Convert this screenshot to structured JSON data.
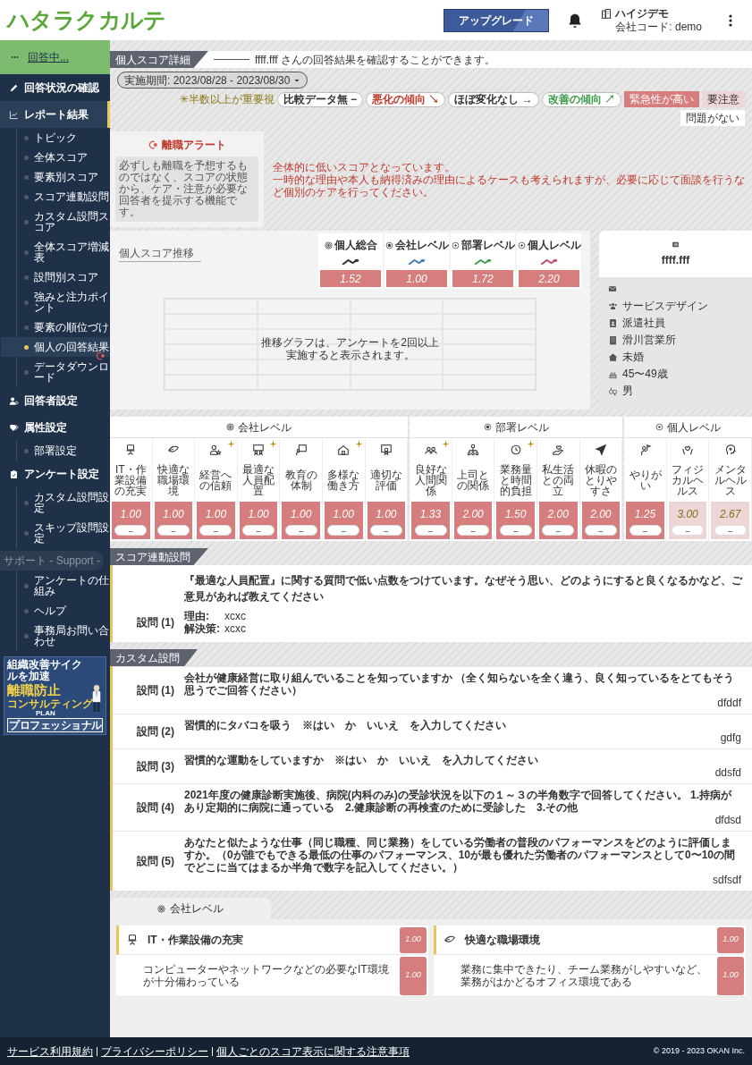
{
  "header": {
    "logo": "ハタラクカルテ",
    "upgrade_button": "アップグレード",
    "company_name": "ハイジデモ",
    "company_code": "会社コード: demo"
  },
  "sidebar": {
    "status": "回答中...",
    "items": [
      {
        "label": "回答状況の確認",
        "selected": false
      },
      {
        "label": "レポート結果",
        "selected": true,
        "children": [
          {
            "label": "トピック",
            "selected": false,
            "alert": false
          },
          {
            "label": "全体スコア",
            "selected": false,
            "alert": false
          },
          {
            "label": "要素別スコア",
            "selected": false,
            "alert": false
          },
          {
            "label": "スコア連動設問",
            "selected": false,
            "alert": false
          },
          {
            "label": "カスタム設問スコア",
            "selected": false,
            "alert": false
          },
          {
            "label": "全体スコア増減表",
            "selected": false,
            "alert": false
          },
          {
            "label": "設問別スコア",
            "selected": false,
            "alert": false
          },
          {
            "label": "強みと注力ポイント",
            "selected": false,
            "alert": false
          },
          {
            "label": "要素の順位づけ",
            "selected": false,
            "alert": false
          },
          {
            "label": "個人の回答結果",
            "selected": true,
            "alert": true
          },
          {
            "label": "データダウンロード",
            "selected": false,
            "alert": false
          }
        ]
      },
      {
        "label": "回答者設定",
        "selected": false
      },
      {
        "label": "属性設定",
        "selected": false,
        "children": [
          {
            "label": "部署設定",
            "selected": false,
            "alert": false
          }
        ]
      },
      {
        "label": "アンケート設定",
        "selected": false,
        "children": [
          {
            "label": "カスタム設問設定",
            "selected": false,
            "alert": false
          },
          {
            "label": "スキップ設問設定",
            "selected": false,
            "alert": false
          }
        ]
      }
    ],
    "support": {
      "label": "サポート - Support -",
      "items": [
        {
          "label": "アンケートの仕組み",
          "selected": false,
          "alert": false
        },
        {
          "label": "ヘルプ",
          "selected": false,
          "alert": false
        },
        {
          "label": "事務局お問い合わせ",
          "selected": false,
          "alert": false
        }
      ]
    },
    "banner": {
      "tagline": "組織改善サイクルを加速",
      "headline": "離職防止",
      "subline": "コンサルティング",
      "plan_label": "PLAN",
      "plan_name": "プロフェッショナル"
    }
  },
  "page": {
    "title": "個人スコア詳細",
    "description": "ffff.fff さんの回答結果を確認することができます。",
    "period": "実施期間: 2023/08/28 - 2023/08/30",
    "legend": [
      {
        "kind": "note",
        "mark": "✳",
        "label": "半数以上が重要視"
      },
      {
        "kind": "trend",
        "label": "比較データ無",
        "arrow": "−",
        "color": "#333333"
      },
      {
        "kind": "trend",
        "label": "悪化の傾向",
        "arrow": "↘",
        "color": "#c0392b"
      },
      {
        "kind": "trend",
        "label": "ほぼ変化なし",
        "arrow": "→",
        "color": "#333333"
      },
      {
        "kind": "trend",
        "label": "改善の傾向",
        "arrow": "↗",
        "color": "#3c9a4a"
      },
      {
        "kind": "status",
        "label": "緊急性が高い",
        "color": "#d67d7d"
      },
      {
        "kind": "status",
        "label": "要注意",
        "color": "#ecd6d6"
      },
      {
        "kind": "status",
        "label": "問題がない",
        "color": "#ffffff"
      }
    ]
  },
  "alert": {
    "title": "離職アラート",
    "description": "必ずしも離職を予想するものではなく、スコアの状態から、ケア・注意が必要な回答者を提示する機能です。",
    "message_lines": [
      "全体的に低いスコアとなっています。",
      "一時的な理由や本人も納得済みの理由によるケースも考えられますが、必要に応じて面談を行うなど個別のケアを行ってください。"
    ]
  },
  "trend": {
    "title": "個人スコア推移",
    "summaries": [
      {
        "label": "個人総合",
        "score": "1.52",
        "color": "#333333"
      },
      {
        "label": "会社レベル",
        "score": "1.00",
        "color": "#4a7fb5"
      },
      {
        "label": "部署レベル",
        "score": "1.72",
        "color": "#4a9a5a"
      },
      {
        "label": "個人レベル",
        "score": "2.20",
        "color": "#c0506a"
      }
    ],
    "empty_message_lines": [
      "推移グラフは、アンケートを2回以上",
      "実施すると表示されます。"
    ]
  },
  "profile": {
    "name": "ffff.fff",
    "attributes": [
      {
        "kind": "department",
        "value": "サービスデザイン"
      },
      {
        "kind": "employment",
        "value": "派遣社員"
      },
      {
        "kind": "office",
        "value": "滑川営業所"
      },
      {
        "kind": "marital",
        "value": "未婚"
      },
      {
        "kind": "age",
        "value": "45〜49歳"
      },
      {
        "kind": "gender",
        "value": "男"
      }
    ]
  },
  "scores": {
    "groups": [
      {
        "label": "会社レベル",
        "items": [
          {
            "label": "IT・作業設備の充実",
            "score": "1.00",
            "color": "#d67d7d",
            "important": false,
            "trend": "–"
          },
          {
            "label": "快適な職場環境",
            "score": "1.00",
            "color": "#d67d7d",
            "important": false,
            "trend": "–"
          },
          {
            "label": "経営への信頼",
            "score": "1.00",
            "color": "#d67d7d",
            "important": true,
            "trend": "–"
          },
          {
            "label": "最適な人員配置",
            "score": "1.00",
            "color": "#d67d7d",
            "important": true,
            "trend": "–"
          },
          {
            "label": "教育の体制",
            "score": "1.00",
            "color": "#d67d7d",
            "important": false,
            "trend": "–"
          },
          {
            "label": "多様な働き方",
            "score": "1.00",
            "color": "#d67d7d",
            "important": true,
            "trend": "–"
          },
          {
            "label": "適切な評価",
            "score": "1.00",
            "color": "#d67d7d",
            "important": false,
            "trend": "–"
          }
        ]
      },
      {
        "label": "部署レベル",
        "items": [
          {
            "label": "良好な人間関係",
            "score": "1.33",
            "color": "#d67d7d",
            "important": true,
            "trend": "–"
          },
          {
            "label": "上司との関係",
            "score": "2.00",
            "color": "#d67d7d",
            "important": false,
            "trend": "–"
          },
          {
            "label": "業務量と時間的負担",
            "score": "1.50",
            "color": "#d67d7d",
            "important": true,
            "trend": "–"
          },
          {
            "label": "私生活との両立",
            "score": "2.00",
            "color": "#d67d7d",
            "important": false,
            "trend": "–"
          },
          {
            "label": "休暇のとりやすさ",
            "score": "2.00",
            "color": "#d67d7d",
            "important": false,
            "trend": "–"
          }
        ]
      },
      {
        "label": "個人レベル",
        "items": [
          {
            "label": "やりがい",
            "score": "1.25",
            "color": "#d67d7d",
            "important": false,
            "trend": "–"
          },
          {
            "label": "フィジカルヘルス",
            "score": "3.00",
            "color": "#ecd6d6",
            "important": false,
            "trend": "–"
          },
          {
            "label": "メンタルヘルス",
            "score": "2.67",
            "color": "#ecd6d6",
            "important": false,
            "trend": "–"
          }
        ]
      }
    ]
  },
  "linked": {
    "title": "スコア連動設問",
    "questions": [
      {
        "number": "設問 (1)",
        "text": "『最適な人員配置』に関する質問で低い点数をつけています。なぜそう思い、どのようにすると良くなるかなど、ご意見があれば教えてください",
        "answers": [
          {
            "label": "理由:",
            "value": "xcxc"
          },
          {
            "label": "解決策:",
            "value": "xcxc"
          }
        ]
      }
    ]
  },
  "custom": {
    "title": "カスタム設問",
    "questions": [
      {
        "number": "設問 (1)",
        "text": "会社が健康経営に取り組んでいることを知っていますか （全く知らないを全く違う、良く知っているをとてもそう思うでご回答ください）",
        "answer": "dfddf"
      },
      {
        "number": "設問 (2)",
        "text": "習慣的にタバコを吸う　※はい　か　いいえ　を入力してください",
        "answer": "gdfg"
      },
      {
        "number": "設問 (3)",
        "text": "習慣的な運動をしていますか　※はい　か　いいえ　を入力してください",
        "answer": "ddsfd"
      },
      {
        "number": "設問 (4)",
        "text": "2021年度の健康診断実施後、病院(内科のみ)の受診状況を以下の１～３の半角数字で回答してください。 1.持病があり定期的に病院に通っている　2.健康診断の再検査のために受診した　3.その他",
        "answer": "dfdsd"
      },
      {
        "number": "設問 (5)",
        "text": "あなたと似たような仕事（同じ職種、同じ業務）をしている労働者の普段のパフォーマンスをどのように評価しますか。（0が誰でもできる最低の仕事のパフォーマンス、10が最も優れた労働者のパフォーマンスとして0〜10の間でどこに当てはまるか半角で数字を記入してください。）",
        "answer": "sdfsdf"
      }
    ]
  },
  "detail": {
    "tab": "会社レベル",
    "columns": [
      {
        "element": "IT・作業設備の充実",
        "score": "1.00",
        "color": "#d67d7d",
        "questions": [
          {
            "text": "コンピューターやネットワークなどの必要なIT環境が十分備わっている",
            "score": "1.00",
            "color": "#d67d7d"
          }
        ]
      },
      {
        "element": "快適な職場環境",
        "score": "1.00",
        "color": "#d67d7d",
        "questions": [
          {
            "text": "業務に集中できたり、チーム業務がしやすいなど、業務がはかどるオフィス環境である",
            "score": "1.00",
            "color": "#d67d7d"
          }
        ]
      }
    ]
  },
  "footer": {
    "links": [
      "サービス利用規約",
      "プライバシーポリシー",
      "個人ごとのスコア表示に関する注意事項"
    ],
    "copyright": "© 2019 - 2023 OKAN Inc."
  }
}
